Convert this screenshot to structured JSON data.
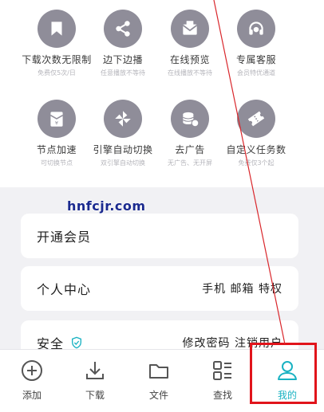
{
  "features": [
    {
      "icon": "bookmark-icon",
      "label": "下载次数无限制",
      "sub": "免费仅5次/日"
    },
    {
      "icon": "share-icon",
      "label": "边下边播",
      "sub": "任意播放不等待"
    },
    {
      "icon": "mail-icon",
      "label": "在线预览",
      "sub": "在线播放不等待"
    },
    {
      "icon": "headset-icon",
      "label": "专属客服",
      "sub": "会员特优通道"
    },
    {
      "icon": "coin-envelope-icon",
      "label": "节点加速",
      "sub": "可切换节点"
    },
    {
      "icon": "pinwheel-icon",
      "label": "引擎自动切换",
      "sub": "双引擎自动切换"
    },
    {
      "icon": "coins-icon",
      "label": "去广告",
      "sub": "无广告、无开屏"
    },
    {
      "icon": "ticket-icon",
      "label": "自定义任务数",
      "sub": "免费仅3个起"
    }
  ],
  "watermark": "hnfcjr.com",
  "menu": {
    "vip": {
      "title": "开通会员"
    },
    "personal": {
      "title": "个人中心",
      "right": "手机 邮箱 特权"
    },
    "security": {
      "title": "安全",
      "right": "修改密码  注销用户"
    }
  },
  "nav": [
    {
      "icon": "add-icon",
      "label": "添加"
    },
    {
      "icon": "download-icon",
      "label": "下载"
    },
    {
      "icon": "folder-icon",
      "label": "文件"
    },
    {
      "icon": "search-grid-icon",
      "label": "查找"
    },
    {
      "icon": "profile-icon",
      "label": "我的",
      "active": true
    }
  ],
  "colors": {
    "icon_gray": "#8f8d99",
    "accent": "#19b2c2",
    "annotation_red": "#e1141b",
    "watermark": "#1b2a8f"
  }
}
